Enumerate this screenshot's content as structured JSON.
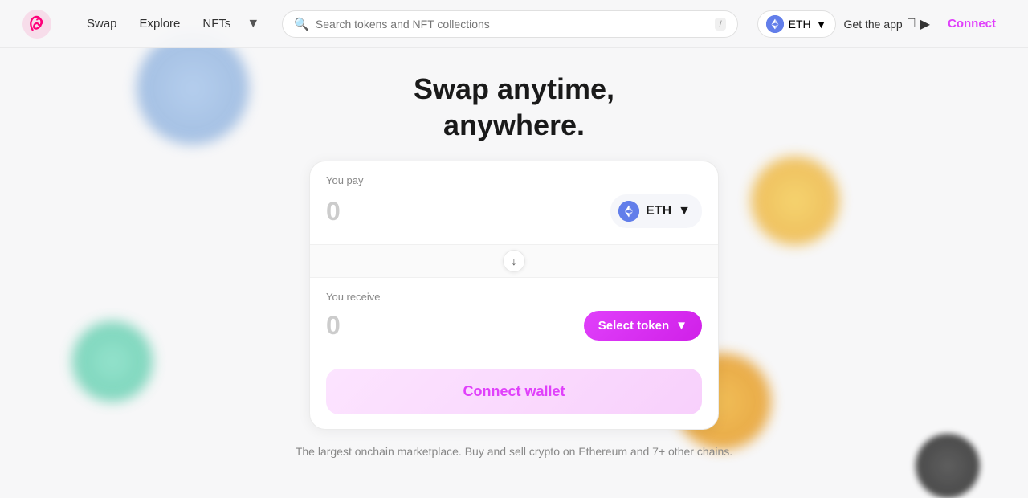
{
  "navbar": {
    "logo_alt": "Uniswap Logo",
    "nav_items": [
      {
        "label": "Swap",
        "id": "swap"
      },
      {
        "label": "Explore",
        "id": "explore"
      },
      {
        "label": "NFTs",
        "id": "nfts"
      }
    ],
    "search_placeholder": "Search tokens and NFT collections",
    "search_slash": "/",
    "eth_network": "ETH",
    "get_app_label": "Get the app",
    "connect_label": "Connect"
  },
  "hero": {
    "title_line1": "Swap anytime,",
    "title_line2": "anywhere."
  },
  "swap": {
    "pay_label": "You pay",
    "pay_amount": "0",
    "pay_token": "ETH",
    "receive_label": "You receive",
    "receive_amount": "0",
    "select_token_label": "Select token",
    "connect_wallet_label": "Connect wallet",
    "footer_text": "The largest onchain marketplace. Buy and sell crypto on\nEthereum and 7+ other chains."
  }
}
